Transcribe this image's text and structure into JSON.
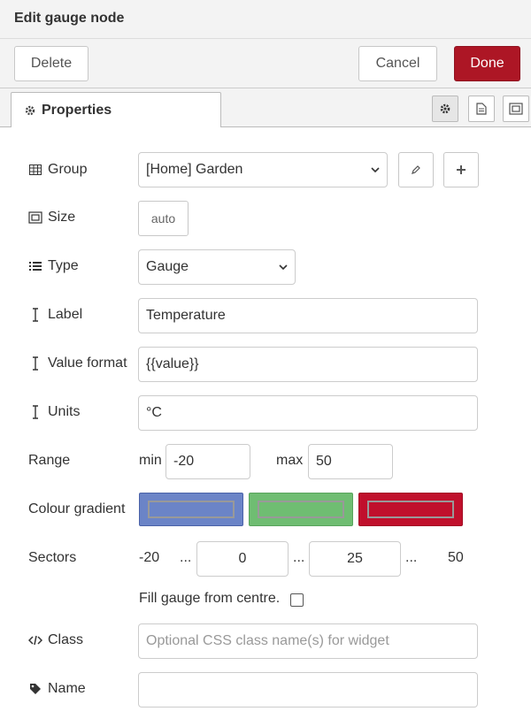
{
  "dialog": {
    "title": "Edit gauge node"
  },
  "toolbar": {
    "delete_label": "Delete",
    "cancel_label": "Cancel",
    "done_label": "Done"
  },
  "tabs": {
    "properties_label": "Properties"
  },
  "form": {
    "group": {
      "label": "Group",
      "value": "[Home] Garden"
    },
    "size": {
      "label": "Size",
      "value": "auto"
    },
    "type": {
      "label": "Type",
      "value": "Gauge"
    },
    "label_field": {
      "label": "Label",
      "value": "Temperature"
    },
    "value_format": {
      "label": "Value format",
      "value": "{{value}}"
    },
    "units": {
      "label": "Units",
      "value": "°C"
    },
    "range": {
      "label": "Range",
      "min_label": "min",
      "min_value": "-20",
      "max_label": "max",
      "max_value": "50"
    },
    "colour_gradient": {
      "label": "Colour gradient",
      "colors": [
        "#6b84c7",
        "#6fbd72",
        "#c0102c"
      ]
    },
    "sectors": {
      "label": "Sectors",
      "start": "-20",
      "sep": "...",
      "first": "0",
      "second": "25",
      "end": "50"
    },
    "fill_gauge": {
      "label": "Fill gauge from centre.",
      "checked": false
    },
    "class_field": {
      "label": "Class",
      "placeholder": "Optional CSS class name(s) for widget"
    },
    "name_field": {
      "label": "Name",
      "value": ""
    }
  },
  "colors": {
    "accent": "#ad1625"
  }
}
